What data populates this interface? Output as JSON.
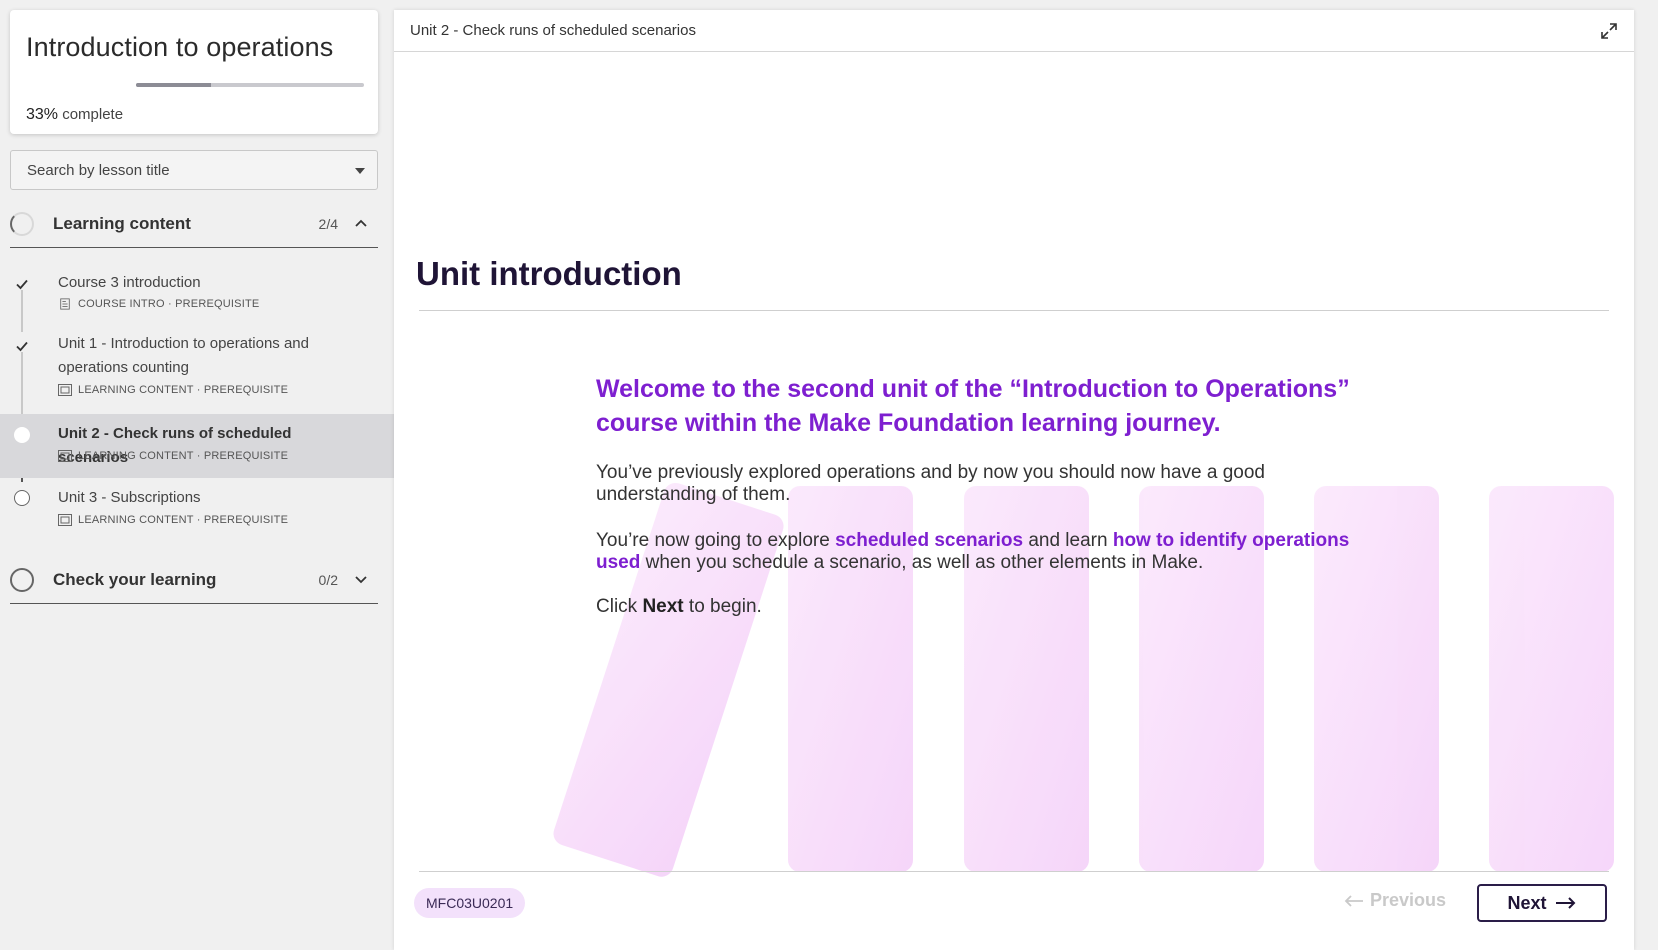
{
  "sidebar": {
    "course_title": "Introduction to operations",
    "progress": {
      "percent": 33,
      "percent_label": "33%",
      "suffix": "complete"
    },
    "search": {
      "placeholder": "Search by lesson title"
    },
    "sections": [
      {
        "title": "Learning content",
        "count": "2/4",
        "expanded": true,
        "lessons": [
          {
            "title": "Course 3 introduction",
            "meta": "COURSE INTRO · PREREQUISITE",
            "status": "done"
          },
          {
            "title": "Unit 1 - Introduction to operations and operations counting",
            "meta": "LEARNING CONTENT · PREREQUISITE",
            "status": "done"
          },
          {
            "title": "Unit 2 - Check runs of scheduled scenarios",
            "meta": "LEARNING CONTENT · PREREQUISITE",
            "status": "current"
          },
          {
            "title": "Unit 3 - Subscriptions",
            "meta": "LEARNING CONTENT · PREREQUISITE",
            "status": "todo"
          }
        ]
      },
      {
        "title": "Check your learning",
        "count": "0/2",
        "expanded": false
      }
    ]
  },
  "main": {
    "header_title": "Unit 2 - Check runs of scheduled scenarios",
    "unit_heading": "Unit introduction",
    "welcome": "Welcome to the second unit of the “Introduction to Operations” course within the Make Foundation learning journey.",
    "para1": "You’ve previously explored operations and by now you should now have a good understanding of them.",
    "para2": {
      "a": "You’re now going to explore ",
      "b": "scheduled scenarios",
      "c": " and learn ",
      "d": "how to identify operations used",
      "e": " when you schedule a scenario, as well as other elements in Make."
    },
    "para3": {
      "a": "Click ",
      "b": "Next",
      "c": " to begin."
    },
    "lesson_code": "MFC03U0201",
    "prev_label": "Previous",
    "next_label": "Next"
  },
  "colors": {
    "accent_purple": "#7e1fd0",
    "dark_navy": "#1f1436",
    "badge_bg": "#f3e1fb",
    "deco_pink": "#f6d2fa"
  },
  "icons": [
    "check-icon",
    "document-icon",
    "monitor-icon",
    "chevron-up-icon",
    "chevron-down-icon",
    "expand-icon",
    "arrow-left-icon",
    "arrow-right-icon",
    "dropdown-caret-icon"
  ]
}
